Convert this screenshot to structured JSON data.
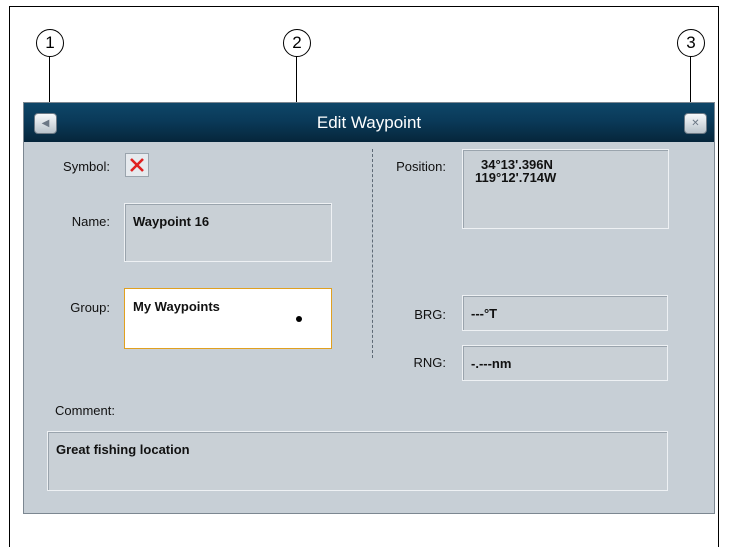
{
  "callouts": {
    "one": "1",
    "two": "2",
    "three": "3"
  },
  "dialog": {
    "title": "Edit Waypoint",
    "left_button_icon": "back-icon",
    "right_button_icon": "close-icon"
  },
  "form": {
    "symbol_label": "Symbol:",
    "symbol_icon": "red-x-icon",
    "name_label": "Name:",
    "name_value": "Waypoint 16",
    "group_label": "Group:",
    "group_value": "My Waypoints",
    "position_label": "Position:",
    "position_lat": "34°13'.396N",
    "position_lon": "119°12'.714W",
    "brg_label": "BRG:",
    "brg_value": "---°T",
    "rng_label": "RNG:",
    "rng_value": "-.---nm",
    "comment_label": "Comment:",
    "comment_value": "Great fishing location"
  },
  "colors": {
    "titlebar": "#0a3a59",
    "dialog_bg": "#c7cfd6",
    "active_border": "#e0a020",
    "symbol_x": "#e02020"
  }
}
